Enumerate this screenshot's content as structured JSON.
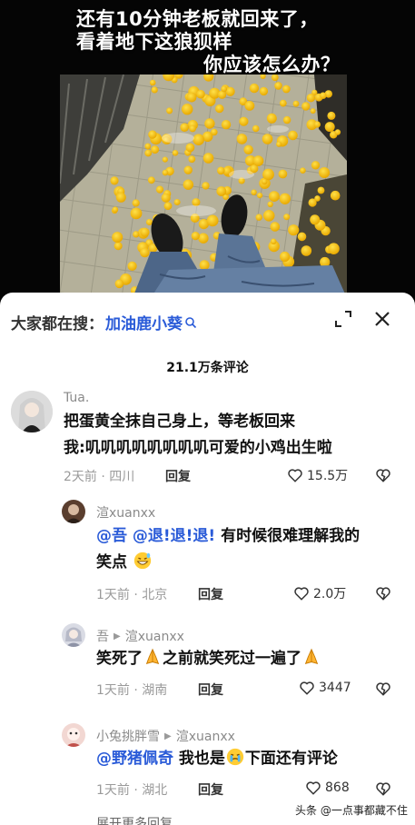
{
  "video": {
    "caption_line1": "还有10分钟老板就回来了，",
    "caption_line2": "看着地下这狼狈样",
    "caption_line3": "你应该怎么办？"
  },
  "search": {
    "prefix": "大家都在搜：",
    "term": "加油鹿小葵"
  },
  "comment_count": "21.1万条评论",
  "comments": [
    {
      "user": "Tua.",
      "line1": "把蛋黄全抹自己身上，等老板回来",
      "line2": "我:叽叽叽叽叽叽叽叽可爱的小鸡出生啦",
      "meta": "2天前 · 四川",
      "reply": "回复",
      "likes": "15.5万"
    },
    {
      "user": "渲xuanxx",
      "mention": "@吾",
      "mention2": "@退!退!退!",
      "text": "有时候很难理解我的",
      "text2": "笑点",
      "meta": "1天前 · 北京",
      "reply": "回复",
      "likes": "2.0万"
    },
    {
      "user": "吾",
      "reply_to": "渲xuanxx",
      "text_a": "笑死了",
      "text_b": "之前就笑死过一遍了",
      "meta": "1天前 · 湖南",
      "reply": "回复",
      "likes": "3447"
    },
    {
      "user": "小兔挑胖雪",
      "reply_to": "渲xuanxx",
      "mention": "@野猪佩奇",
      "text_a": "我也是",
      "text_b": "下面还有评论",
      "meta": "1天前 · 湖北",
      "reply": "回复",
      "likes": "868"
    }
  ],
  "more_replies": "展开更多回复",
  "watermark": "头条 @一点事都藏不住",
  "colors": {
    "link_blue": "#2a5bd8",
    "yolk": "#f2c200",
    "sheet_bg": "#ffffff"
  }
}
